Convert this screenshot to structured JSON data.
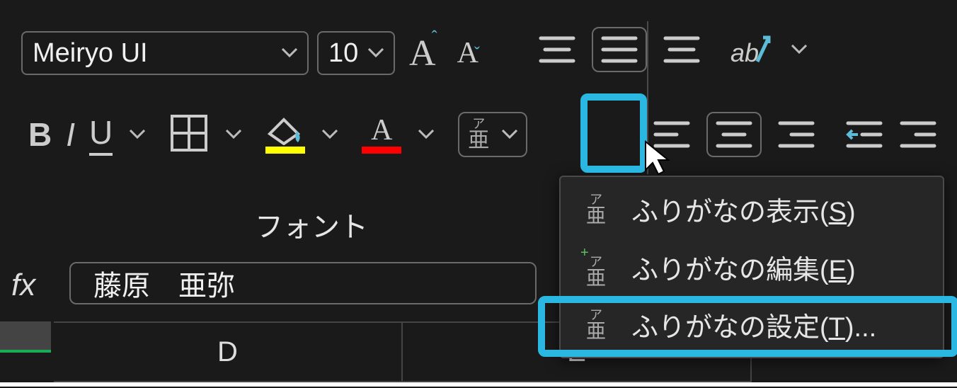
{
  "font": {
    "name": "Meiryo UI",
    "size": "10"
  },
  "group_label": "フォント",
  "formula": {
    "fx": "fx",
    "value": "藤原　亜弥"
  },
  "columns": [
    "D",
    "E"
  ],
  "menu": {
    "show_furigana": "ふりがなの表示(",
    "show_furigana_key": "S",
    "show_furigana_tail": ")",
    "edit_furigana": "ふりがなの編集(",
    "edit_furigana_key": "E",
    "edit_furigana_tail": ")",
    "settings_furigana": "ふりがなの設定(",
    "settings_furigana_key": "T",
    "settings_furigana_tail": ")...",
    "icon_small": "ア",
    "icon_kanji": "亜"
  },
  "buttons": {
    "bold": "B",
    "italic": "I",
    "underline": "U",
    "font_color_letter": "A"
  },
  "colors": {
    "highlight": "#2ab7e2",
    "fill_underline": "#ffff00",
    "font_underline": "#ff0000"
  }
}
